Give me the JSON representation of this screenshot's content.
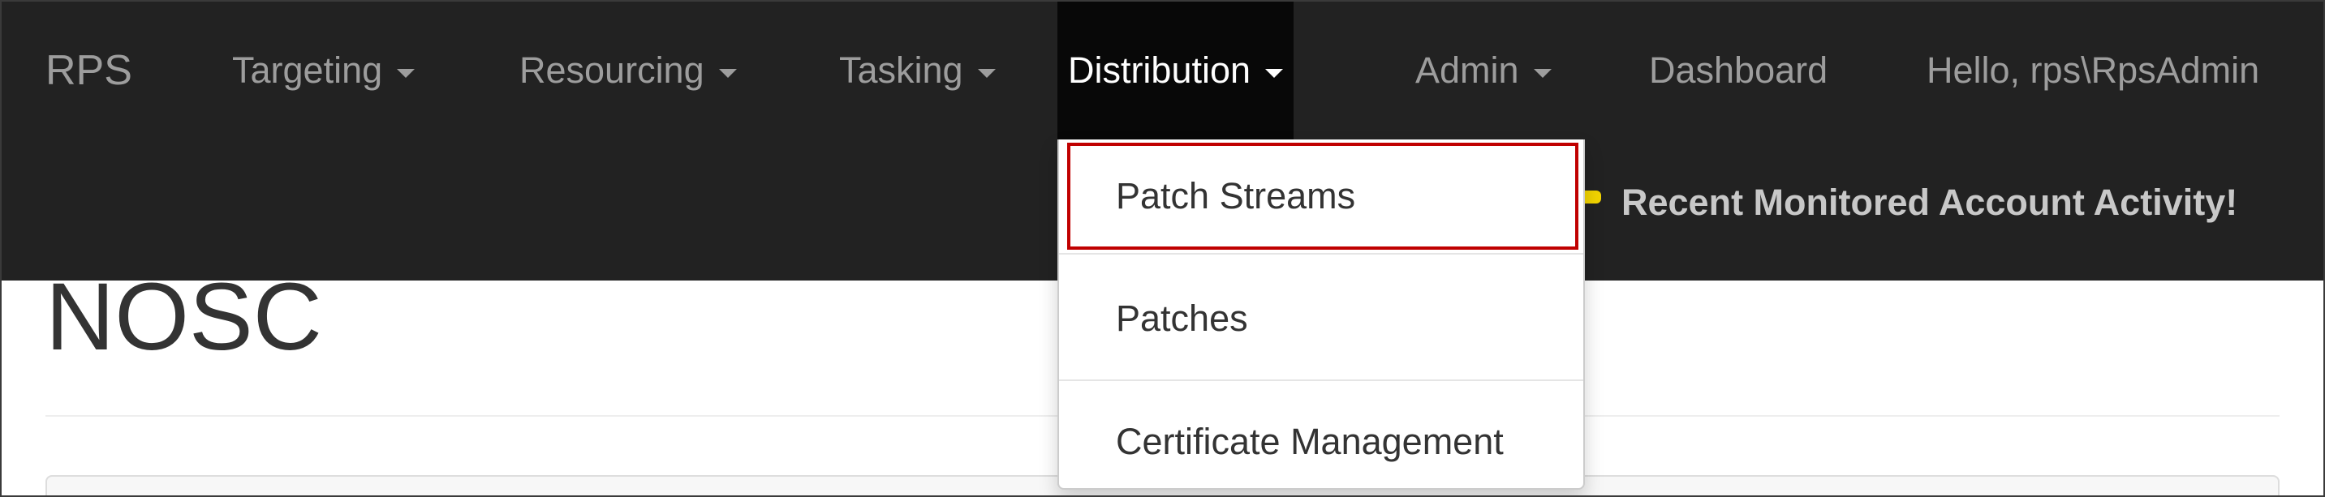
{
  "navbar": {
    "brand": "RPS",
    "items": [
      {
        "label": "Targeting",
        "has_dropdown": true
      },
      {
        "label": "Resourcing",
        "has_dropdown": true
      },
      {
        "label": "Tasking",
        "has_dropdown": true
      },
      {
        "label": "Distribution",
        "has_dropdown": true,
        "active": true
      },
      {
        "label": "Admin",
        "has_dropdown": true
      },
      {
        "label": "Dashboard",
        "has_dropdown": false
      }
    ],
    "greeting": "Hello, rps\\RpsAdmin",
    "alert_text": "Recent Monitored Account Activity!",
    "alert_icon": "flag-icon",
    "background_color": "#222222",
    "active_background_color": "#080808",
    "alert_icon_color": "#f2d400"
  },
  "dropdown": {
    "items": [
      {
        "label": "Patch Streams",
        "highlighted": true
      },
      {
        "label": "Patches",
        "highlighted": false
      },
      {
        "label": "Certificate Management",
        "highlighted": false
      }
    ],
    "highlight_color": "#c00000"
  },
  "page": {
    "title": "NOSC"
  }
}
